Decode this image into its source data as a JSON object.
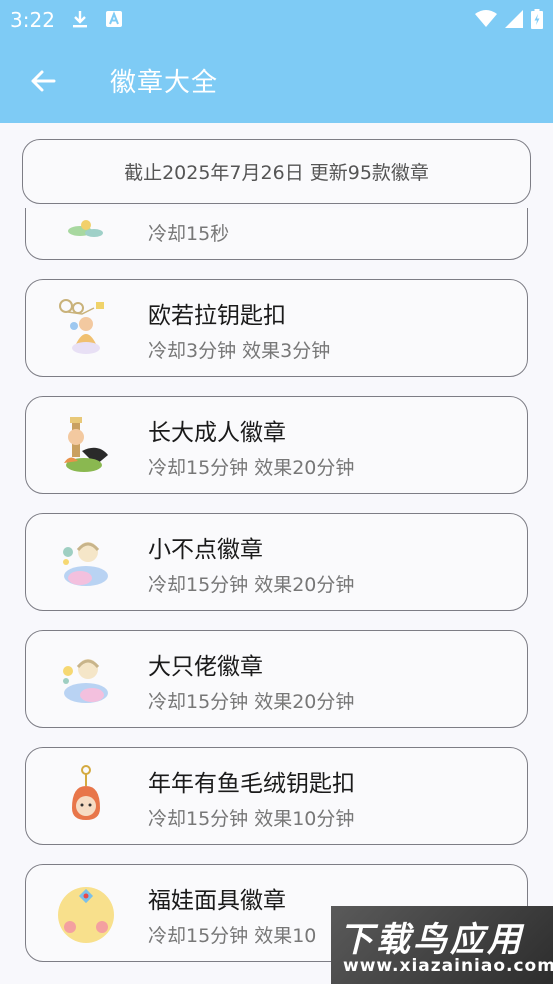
{
  "status_bar": {
    "time": "3:22",
    "icons": [
      "download-icon",
      "a-icon",
      "wifi-icon",
      "signal-icon",
      "battery-icon"
    ]
  },
  "app_bar": {
    "back_icon": "arrow-left-icon",
    "title": "徽章大全",
    "color": "#7ecbf5"
  },
  "notice": {
    "text": "截止2025年7月26日 更新95款徽章"
  },
  "badges": [
    {
      "title": "",
      "subtitle": "冷却15秒",
      "icon": "plant-badge-icon"
    },
    {
      "title": "欧若拉钥匙扣",
      "subtitle": "冷却3分钟 效果3分钟",
      "icon": "aurora-keychain-icon"
    },
    {
      "title": "长大成人徽章",
      "subtitle": "冷却15分钟 效果20分钟",
      "icon": "grown-up-badge-icon"
    },
    {
      "title": "小不点徽章",
      "subtitle": "冷却15分钟 效果20分钟",
      "icon": "tiny-badge-icon"
    },
    {
      "title": "大只佬徽章",
      "subtitle": "冷却15分钟 效果20分钟",
      "icon": "big-badge-icon"
    },
    {
      "title": "年年有鱼毛绒钥匙扣",
      "subtitle": "冷却15分钟 效果10分钟",
      "icon": "fish-plush-keychain-icon"
    },
    {
      "title": "福娃面具徽章",
      "subtitle": "冷却15分钟 效果10",
      "icon": "fuwa-mask-badge-icon"
    }
  ],
  "watermark": {
    "main": "下载鸟应用",
    "sub": "www.xiazainiao.com"
  }
}
